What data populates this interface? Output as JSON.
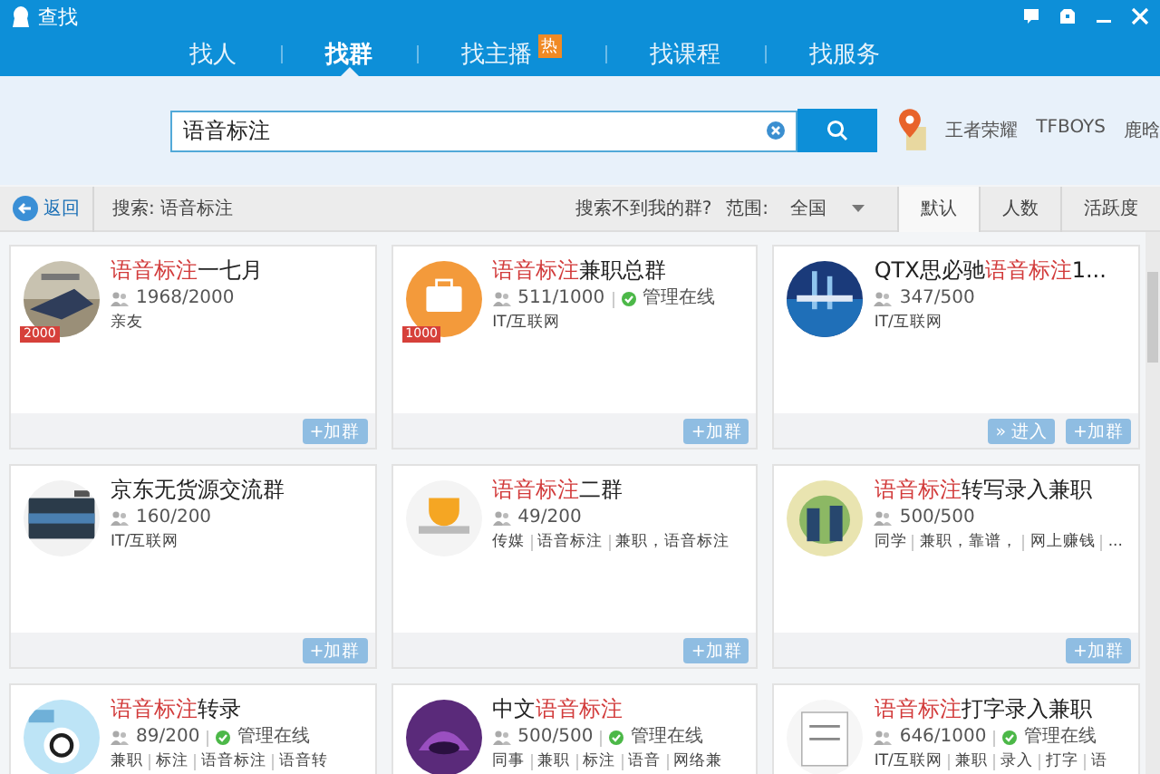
{
  "window": {
    "title": "查找"
  },
  "nav_tabs": [
    {
      "label": "找人",
      "selected": false
    },
    {
      "label": "找群",
      "selected": true
    },
    {
      "label": "找主播",
      "selected": false,
      "badge": "热"
    },
    {
      "label": "找课程",
      "selected": false
    },
    {
      "label": "找服务",
      "selected": false
    }
  ],
  "search": {
    "value": "语音标注"
  },
  "hot_keywords": [
    "王者荣耀",
    "TFBOYS",
    "鹿晗"
  ],
  "filter_bar": {
    "back": "返回",
    "query": "搜索: 语音标注",
    "help_link": "搜索不到我的群?",
    "range_label": "范围:",
    "range_value": "全国",
    "sort_tabs": [
      {
        "label": "默认",
        "selected": true
      },
      {
        "label": "人数",
        "selected": false
      },
      {
        "label": "活跃度",
        "selected": false
      }
    ]
  },
  "groups": [
    {
      "title_parts": [
        {
          "text": "语音标注",
          "highlight": true
        },
        {
          "text": "一七月",
          "highlight": false
        }
      ],
      "members": "1968/2000",
      "level_badge": "2000",
      "tags": [
        "亲友"
      ],
      "buttons": [
        "+加群"
      ]
    },
    {
      "title_parts": [
        {
          "text": "语音标注",
          "highlight": true
        },
        {
          "text": "兼职总群",
          "highlight": false
        }
      ],
      "members": "511/1000",
      "status": "管理在线",
      "level_badge": "1000",
      "tags": [
        "IT/互联网"
      ],
      "buttons": [
        "+加群"
      ]
    },
    {
      "title_parts": [
        {
          "text": "QTX思必驰",
          "highlight": false
        },
        {
          "text": "语音标注",
          "highlight": true
        },
        {
          "text": "1...",
          "highlight": false
        }
      ],
      "members": "347/500",
      "tags": [
        "IT/互联网"
      ],
      "buttons": [
        "» 进入",
        "+加群"
      ]
    },
    {
      "title_parts": [
        {
          "text": "京东无货源交流群",
          "highlight": false
        }
      ],
      "members": "160/200",
      "tags": [
        "IT/互联网"
      ],
      "buttons": [
        "+加群"
      ]
    },
    {
      "title_parts": [
        {
          "text": "语音标注",
          "highlight": true
        },
        {
          "text": "二群",
          "highlight": false
        }
      ],
      "members": "49/200",
      "tags": [
        "传媒",
        "语音标注",
        "兼职，语音标注"
      ],
      "buttons": [
        "+加群"
      ]
    },
    {
      "title_parts": [
        {
          "text": "语音标注",
          "highlight": true
        },
        {
          "text": "转写录入兼职",
          "highlight": false
        }
      ],
      "members": "500/500",
      "tags": [
        "同学",
        "兼职，靠谱，",
        "网上赚钱",
        "..."
      ],
      "buttons": [
        "+加群"
      ]
    },
    {
      "title_parts": [
        {
          "text": "语音标注",
          "highlight": true
        },
        {
          "text": "转录",
          "highlight": false
        }
      ],
      "members": "89/200",
      "status": "管理在线",
      "tags": [
        "兼职",
        "标注",
        "语音标注",
        "语音转"
      ]
    },
    {
      "title_parts": [
        {
          "text": "中文",
          "highlight": false
        },
        {
          "text": "语音标注",
          "highlight": true
        }
      ],
      "members": "500/500",
      "status": "管理在线",
      "tags": [
        "同事",
        "兼职",
        "标注",
        "语音",
        "网络兼"
      ]
    },
    {
      "title_parts": [
        {
          "text": "语音标注",
          "highlight": true
        },
        {
          "text": "打字录入兼职",
          "highlight": false
        }
      ],
      "members": "646/1000",
      "status": "管理在线",
      "tags": [
        "IT/互联网",
        "兼职",
        "录入",
        "打字",
        "语"
      ]
    }
  ]
}
